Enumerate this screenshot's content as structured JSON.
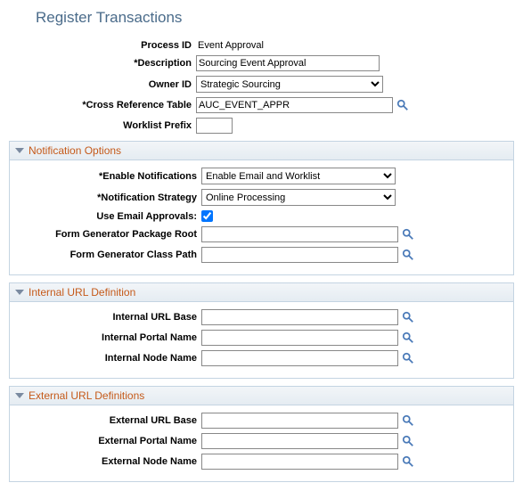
{
  "title": "Register Transactions",
  "main": {
    "process_id_label": "Process ID",
    "process_id_value": "Event Approval",
    "description_label": "*Description",
    "description_value": "Sourcing Event Approval",
    "owner_id_label": "Owner ID",
    "owner_id_value": "Strategic Sourcing",
    "xref_label": "*Cross Reference Table",
    "xref_value": "AUC_EVENT_APPR",
    "worklist_prefix_label": "Worklist Prefix",
    "worklist_prefix_value": ""
  },
  "notification": {
    "header": "Notification Options",
    "enable_label": "*Enable Notifications",
    "enable_value": "Enable Email and Worklist",
    "strategy_label": "*Notification Strategy",
    "strategy_value": "Online Processing",
    "email_approvals_label": "Use Email Approvals:",
    "email_approvals_checked": true,
    "pkg_root_label": "Form Generator Package Root",
    "pkg_root_value": "",
    "class_path_label": "Form Generator Class Path",
    "class_path_value": ""
  },
  "internal_url": {
    "header": "Internal URL Definition",
    "base_label": "Internal URL Base",
    "base_value": "",
    "portal_label": "Internal Portal Name",
    "portal_value": "",
    "node_label": "Internal Node Name",
    "node_value": ""
  },
  "external_url": {
    "header": "External URL Definitions",
    "base_label": "External URL Base",
    "base_value": "",
    "portal_label": "External Portal Name",
    "portal_value": "",
    "node_label": "External Node Name",
    "node_value": ""
  }
}
